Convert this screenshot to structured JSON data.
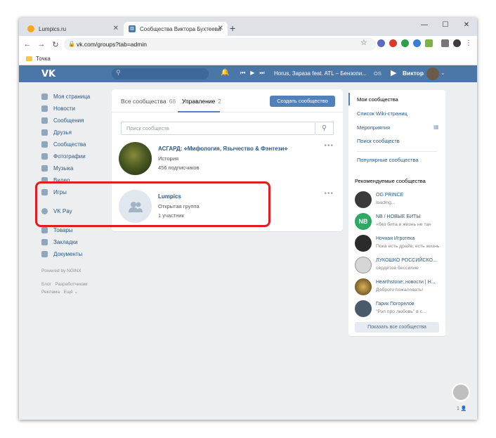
{
  "browser": {
    "tabs": [
      {
        "title": "Lumpics.ru",
        "active": false
      },
      {
        "title": "Сообщества Виктора Бухтеева",
        "active": true
      }
    ],
    "url": "vk.com/groups?tab=admin",
    "bookmark": "Точка"
  },
  "header": {
    "logo": "VK",
    "track": "Horus, Зараза feat. ATL – Бензопи...",
    "os_label": "OS",
    "username": "Виктор"
  },
  "leftnav": {
    "items": [
      "Моя страница",
      "Новости",
      "Сообщения",
      "Друзья",
      "Сообщества",
      "Фотографии",
      "Музыка",
      "Видео",
      "Игры"
    ],
    "pay": "VK Pay",
    "items2": [
      "Товары",
      "Закладки",
      "Документы"
    ],
    "powered": "Powered by NGINX",
    "footer1": "Блог   Разработчикам",
    "footer2": "Реклама   Ещё ⌄"
  },
  "main": {
    "tab_all": "Все сообщества",
    "tab_all_count": "68",
    "tab_manage": "Управление",
    "tab_manage_count": "2",
    "create_button": "Создать сообщество",
    "search_placeholder": "Поиск сообществ",
    "groups": [
      {
        "name": "АСГАРД: ⟡Мифология, Язычество & Фэнтези⟡",
        "category": "История",
        "members": "456 подписчиков"
      },
      {
        "name": "Lumpics",
        "category": "Открытая группа",
        "members": "1 участник"
      }
    ]
  },
  "rightmenu": {
    "items": [
      "Мои сообщества",
      "Список Wiki-страниц",
      "Мероприятия",
      "Поиск сообществ",
      "Популярные сообщества"
    ]
  },
  "recommended": {
    "title": "Рекомендуемые сообщества",
    "items": [
      {
        "name": "OG PRINCE",
        "sub": "loading...",
        "color": "#3a3a3a"
      },
      {
        "name": "NB / НОВЫЕ БИТЫ",
        "sub": "«без бита и жизнь не та»",
        "color": "#2ea862"
      },
      {
        "name": "Ночная Игротека",
        "sub": "Пока есть драйв, есть жизнь",
        "color": "#2b2b2b"
      },
      {
        "name": "ЛУКОШКО РОССИЙСКО...",
        "sub": "сердитое бессилие",
        "color": "#c9c9c9"
      },
      {
        "name": "Hearthstone: новости | Н...",
        "sub": "Доброго пожаловать!",
        "color": "#8a6a2e"
      },
      {
        "name": "Гарик Погорелов",
        "sub": "\"Рэп про любовь\" в с...",
        "color": "#4b5a6b"
      }
    ],
    "show_all": "Показать все сообщества"
  },
  "chat": {
    "count": "1"
  },
  "colors": {
    "vk_blue": "#4a76a8",
    "link": "#2a5885",
    "highlight": "#e31b23",
    "button": "#5181b8"
  }
}
